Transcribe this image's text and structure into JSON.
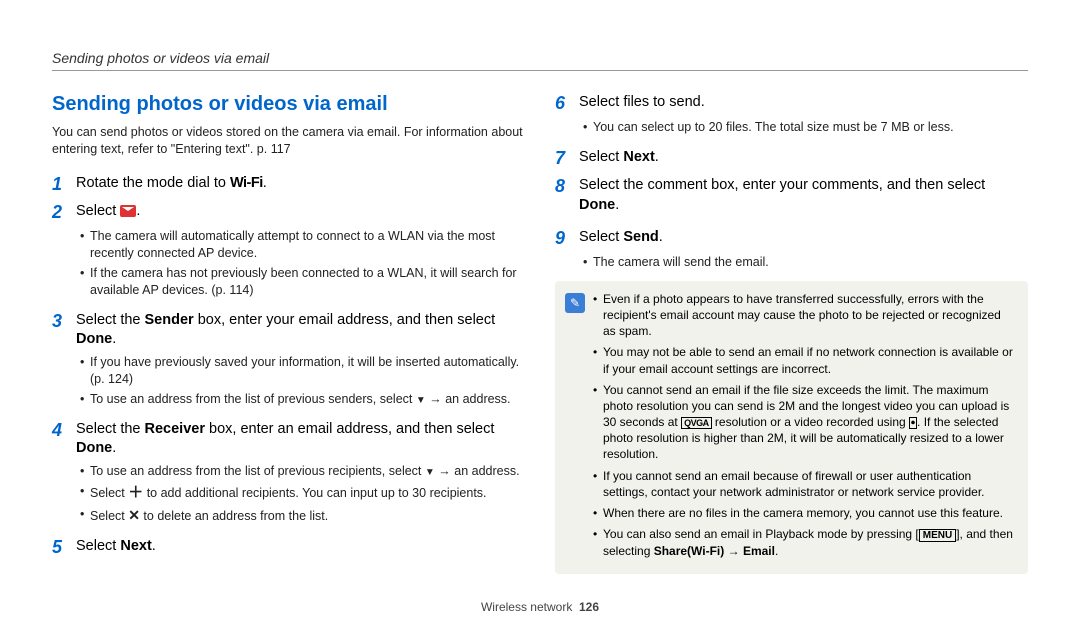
{
  "header": "Sending photos or videos via email",
  "title": "Sending photos or videos via email",
  "intro": "You can send photos or videos stored on the camera via email. For information about entering text, refer to \"Entering text\". p. 117",
  "step1_num": "1",
  "step1_pre": "Rotate the mode dial to ",
  "step1_wifi": "Wi-Fi",
  "step1_post": ".",
  "step2_num": "2",
  "step2_pre": "Select ",
  "step2_post": ".",
  "step2_sub1": "The camera will automatically attempt to connect to a WLAN via the most recently connected AP device.",
  "step2_sub2": "If the camera has not previously been connected to a WLAN, it will search for available AP devices. (p. 114)",
  "step3_num": "3",
  "step3_a": "Select the ",
  "step3_b": "Sender",
  "step3_c": " box, enter your email address, and then select ",
  "step3_d": "Done",
  "step3_e": ".",
  "step3_sub1": "If you have previously saved your information, it will be inserted automatically. (p. 124)",
  "step3_sub2a": "To use an address from the list of previous senders, select ",
  "step3_sub2b": " → an address.",
  "step4_num": "4",
  "step4_a": "Select the ",
  "step4_b": "Receiver",
  "step4_c": " box, enter an email address, and then select ",
  "step4_d": "Done",
  "step4_e": ".",
  "step4_sub1a": "To use an address from the list of previous recipients, select ",
  "step4_sub1b": " → an address.",
  "step4_sub2a": "Select ",
  "step4_sub2b": " to add additional recipients. You can input up to 30 recipients.",
  "step4_sub3a": "Select ",
  "step4_sub3b": " to delete an address from the list.",
  "step5_num": "5",
  "step5_a": "Select ",
  "step5_b": "Next",
  "step5_c": ".",
  "step6_num": "6",
  "step6": "Select files to send.",
  "step6_sub1": "You can select up to 20 files. The total size must be 7 MB or less.",
  "step7_num": "7",
  "step7_a": "Select ",
  "step7_b": "Next",
  "step7_c": ".",
  "step8_num": "8",
  "step8_a": "Select the comment box, enter your comments, and then select ",
  "step8_b": "Done",
  "step8_c": ".",
  "step9_num": "9",
  "step9_a": "Select ",
  "step9_b": "Send",
  "step9_c": ".",
  "step9_sub1": "The camera will send the email.",
  "note1": "Even if a photo appears to have transferred successfully, errors with the recipient's email account may cause the photo to be rejected or recognized as spam.",
  "note2": "You may not be able to send an email if no network connection is available or if your email account settings are incorrect.",
  "note3a": "You cannot send an email if the file size exceeds the limit. The maximum photo resolution you can send is 2M and the longest video you can upload is 30 seconds at ",
  "note3_qvga": "QVGA",
  "note3b": " resolution or a video recorded using ",
  "note3c": ". If the selected photo resolution is higher than 2M, it will be automatically resized to a lower resolution.",
  "note4": "If you cannot send an email because of firewall or user authentication settings, contact your network administrator or network service provider.",
  "note5": "When there are no files in the camera memory, you cannot use this feature.",
  "note6a": "You can also send an email in Playback mode by pressing [",
  "note6_menu": "MENU",
  "note6b": "], and then selecting ",
  "note6c": "Share(Wi-Fi)",
  "note6d": " → ",
  "note6e": "Email",
  "note6f": ".",
  "footer_section": "Wireless network",
  "footer_page": "126"
}
